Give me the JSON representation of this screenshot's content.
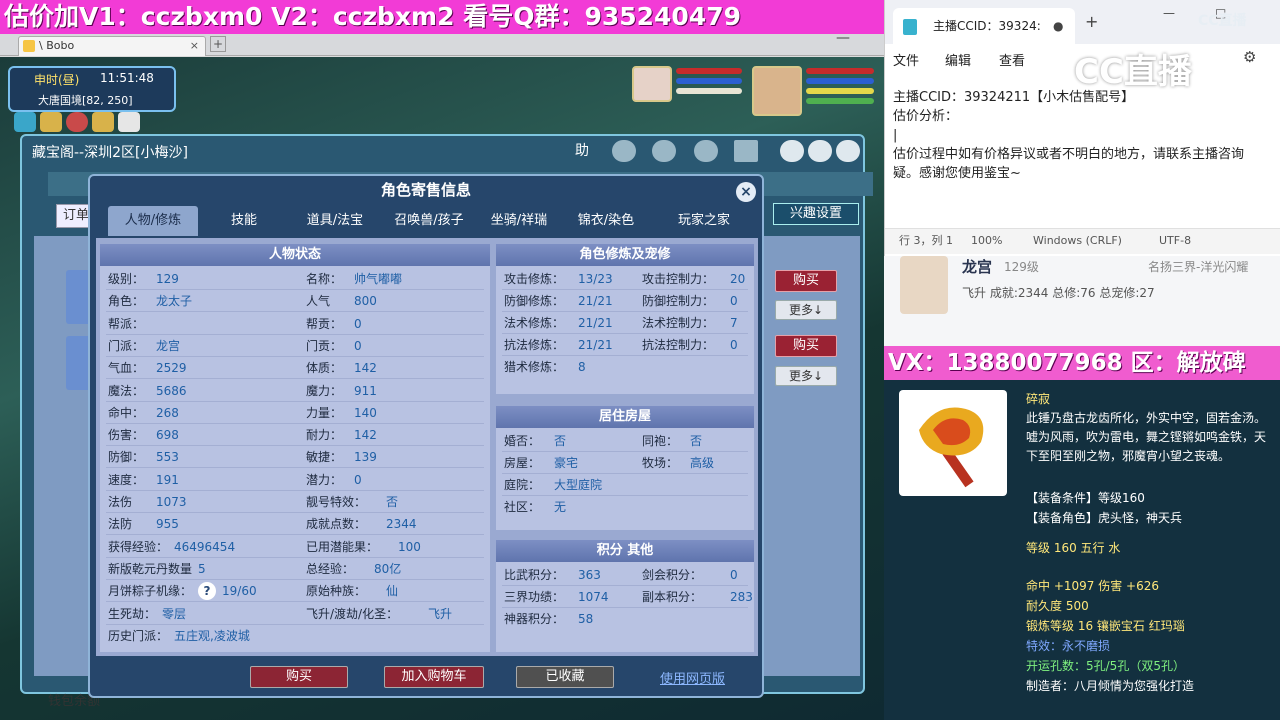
{
  "banner": {
    "text": "估价加V1：cczbxm0     V2：cczbxm2    看号Q群：935240479"
  },
  "bobo": {
    "tab_title": "\\ Bobo",
    "close": "×",
    "plus": "+",
    "minimize": "—"
  },
  "game": {
    "time_label": "申时(昼)",
    "time_value": "11:51:48",
    "location": "大唐国境[82, 250]"
  },
  "treasure": {
    "title": "藏宝阁--深圳2区[小梅沙]",
    "help_label": "助",
    "order_label": "订单",
    "hobby_label": "兴趣设置",
    "buy_label": "购买",
    "more_label": "更多↓",
    "wallet_label": "钱包余额"
  },
  "dialog": {
    "title": "角色寄售信息",
    "close": "×",
    "tabs": [
      "人物/修炼",
      "技能",
      "道具/法宝",
      "召唤兽/孩子",
      "坐骑/祥瑞",
      "锦衣/染色",
      "玩家之家"
    ],
    "status_title": "人物状态",
    "cultivation_title": "角色修炼及宠修",
    "house_title": "居住房屋",
    "score_title": "积分 其他",
    "status_left": [
      {
        "label": "级别：",
        "value": "129"
      },
      {
        "label": "角色：",
        "value": "龙太子"
      },
      {
        "label": "帮派：",
        "value": ""
      },
      {
        "label": "门派：",
        "value": "龙宫"
      },
      {
        "label": "气血：",
        "value": "2529"
      },
      {
        "label": "魔法：",
        "value": "5686"
      },
      {
        "label": "命中：",
        "value": "268"
      },
      {
        "label": "伤害：",
        "value": "698"
      },
      {
        "label": "防御：",
        "value": "553"
      },
      {
        "label": "速度：",
        "value": "191"
      },
      {
        "label": "法伤",
        "value": "1073"
      },
      {
        "label": "法防",
        "value": "955"
      }
    ],
    "status_right": [
      {
        "label": "名称：",
        "value": "帅气嘟嘟"
      },
      {
        "label": "人气",
        "value": "800"
      },
      {
        "label": "帮贡：",
        "value": "0"
      },
      {
        "label": "门贡：",
        "value": "0"
      },
      {
        "label": "体质：",
        "value": "142"
      },
      {
        "label": "魔力：",
        "value": "911"
      },
      {
        "label": "力量：",
        "value": "140"
      },
      {
        "label": "耐力：",
        "value": "142"
      },
      {
        "label": "敏捷：",
        "value": "139"
      },
      {
        "label": "潜力：",
        "value": "0"
      },
      {
        "label": "靓号特效：",
        "value": "否"
      },
      {
        "label": "成就点数：",
        "value": "2344"
      }
    ],
    "status_bottom": [
      {
        "label": "获得经验：",
        "value": "46496454",
        "label2": "已用潜能果：",
        "value2": "100"
      },
      {
        "label": "新版乾元丹数量",
        "value": "5",
        "label2": "总经验：",
        "value2": "80亿"
      },
      {
        "label": "月饼粽子机缘：",
        "value": "19/60",
        "label2": "原始种族：",
        "value2": "仙"
      },
      {
        "label": "生死劫：",
        "value": "零层",
        "label2": "飞升/渡劫/化圣：",
        "value2": "飞升"
      },
      {
        "label": "历史门派：",
        "value": "五庄观,凌波城",
        "label2": "",
        "value2": ""
      }
    ],
    "question_icon": "?",
    "cultivation": [
      {
        "label": "攻击修炼：",
        "value": "13/23",
        "label2": "攻击控制力：",
        "value2": "20"
      },
      {
        "label": "防御修炼：",
        "value": "21/21",
        "label2": "防御控制力：",
        "value2": "0"
      },
      {
        "label": "法术修炼：",
        "value": "21/21",
        "label2": "法术控制力：",
        "value2": "7"
      },
      {
        "label": "抗法修炼：",
        "value": "21/21",
        "label2": "抗法控制力：",
        "value2": "0"
      },
      {
        "label": "猎术修炼：",
        "value": "8",
        "label2": "",
        "value2": ""
      }
    ],
    "house": [
      {
        "label": "婚否：",
        "value": "否",
        "label2": "同袍：",
        "value2": "否"
      },
      {
        "label": "房屋：",
        "value": "豪宅",
        "label2": "牧场：",
        "value2": "高级"
      },
      {
        "label": "庭院：",
        "value": "大型庭院",
        "label2": "",
        "value2": ""
      },
      {
        "label": "社区：",
        "value": "无",
        "label2": "",
        "value2": ""
      }
    ],
    "score": [
      {
        "label": "比武积分：",
        "value": "363",
        "label2": "剑会积分：",
        "value2": "0"
      },
      {
        "label": "三界功绩：",
        "value": "1074",
        "label2": "副本积分：",
        "value2": "283"
      },
      {
        "label": "神器积分：",
        "value": "58",
        "label2": "",
        "value2": ""
      }
    ],
    "buttons": {
      "buy": "购买",
      "cart": "加入购物车",
      "fav": "已收藏",
      "web": "使用网页版"
    }
  },
  "notepad": {
    "tab_title": "主播CCID：39324:",
    "menu": [
      "文件",
      "编辑",
      "查看"
    ],
    "lines": [
      "主播CCID：39324211【小木估售配号】",
      "估价分析：",
      "|",
      "估价过程中如有价格异议或者不明白的地方，请联系主播咨询",
      "疑。感谢您使用鉴宝~"
    ],
    "status": [
      "行 3，列 1",
      "100%",
      "Windows (CRLF)",
      "UTF-8"
    ],
    "watermark": "CC直播",
    "logo": "CC直播"
  },
  "card": {
    "name": "龙宫",
    "level": "129级",
    "server": "名扬三界-洋光闪耀",
    "detail": "飞升 成就:2344 总修:76 总宠修:27"
  },
  "vx": {
    "text": "VX：13880077968 区：解放碑"
  },
  "item": {
    "name": "碎寂",
    "desc": "此锤乃盘古龙齿所化，外实中空，固若金汤。嘘为风雨，吹为雷电，舞之铿锵如鸣金铁，天下至阳至刚之物，邪魔宵小望之丧魂。",
    "cond": "【装备条件】等级160",
    "role": "【装备角色】虎头怪，神天兵",
    "level_line": "等级 160 五行 水",
    "attr_line": "命中 +1097 伤害 +626",
    "durability": "耐久度 500",
    "forge": "锻炼等级 16 镶嵌宝石 红玛瑙",
    "effect": "特效：永不磨损",
    "holes": "开运孔数：5孔/5孔（双5孔）",
    "maker": "制造者：八月倾情为您强化打造"
  },
  "colors": {
    "banner": "#f23bd6",
    "dialog": "#26466b",
    "buy": "#9a2233",
    "value": "#1f5fa5"
  }
}
